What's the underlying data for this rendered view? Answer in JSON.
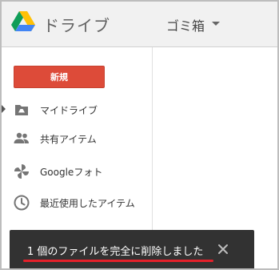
{
  "header": {
    "app_name": "ドライブ",
    "folder_title": "ゴミ箱"
  },
  "sidebar": {
    "new_button_label": "新規",
    "items": [
      {
        "label": "マイドライブ",
        "icon": "my-drive-icon",
        "active": true
      },
      {
        "label": "共有アイテム",
        "icon": "people-icon",
        "active": false
      },
      {
        "label": "Googleフォト",
        "icon": "photos-pinwheel-icon",
        "active": false
      },
      {
        "label": "最近使用したアイテム",
        "icon": "clock-icon",
        "active": false
      }
    ]
  },
  "snackbar": {
    "message": "1 個のファイルを完全に削除しました",
    "close_icon": "close-icon"
  },
  "colors": {
    "accent_red": "#dd4b39",
    "annotation_red": "#e5202a",
    "snackbar_bg": "#323232"
  }
}
